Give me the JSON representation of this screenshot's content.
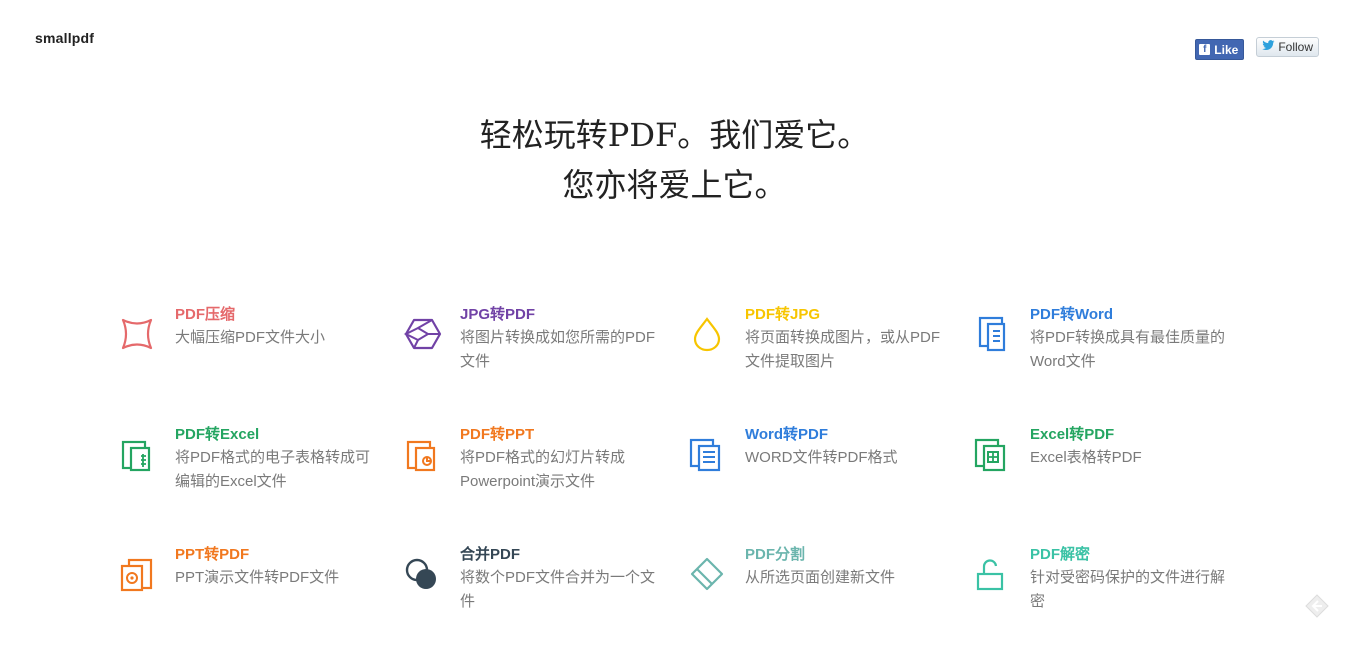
{
  "header": {
    "logo": "smallpdf",
    "fb_like_label": "Like",
    "twitter_follow_label": "Follow"
  },
  "hero": {
    "line1": "轻松玩转PDF。我们爱它。",
    "line2": "您亦将爱上它。"
  },
  "tools": [
    {
      "title": "PDF压缩",
      "desc": "大幅压缩PDF文件大小",
      "color": "#e5696b",
      "icon": "compress-icon"
    },
    {
      "title": "JPG转PDF",
      "desc": "将图片转换成如您所需的PDF文件",
      "color": "#7142a6",
      "icon": "cube-icon"
    },
    {
      "title": "PDF转JPG",
      "desc": "将页面转换成图片，或从PDF文件提取图片",
      "color": "#f7c500",
      "icon": "drop-icon"
    },
    {
      "title": "PDF转Word",
      "desc": "将PDF转换成具有最佳质量的Word文件",
      "color": "#2f7ddb",
      "icon": "word-doc-icon"
    },
    {
      "title": "PDF转Excel",
      "desc": "将PDF格式的电子表格转成可编辑的Excel文件",
      "color": "#24a561",
      "icon": "excel-doc-icon"
    },
    {
      "title": "PDF转PPT",
      "desc": "将PDF格式的幻灯片转成Powerpoint演示文件",
      "color": "#f1781f",
      "icon": "ppt-doc-icon"
    },
    {
      "title": "Word转PDF",
      "desc": "WORD文件转PDF格式",
      "color": "#2f7ddb",
      "icon": "word-lines-icon"
    },
    {
      "title": "Excel转PDF",
      "desc": "Excel表格转PDF",
      "color": "#24a561",
      "icon": "excel-grid-icon"
    },
    {
      "title": "PPT转PDF",
      "desc": "PPT演示文件转PDF文件",
      "color": "#f1781f",
      "icon": "ppt-chart-icon"
    },
    {
      "title": "合并PDF",
      "desc": "将数个PDF文件合并为一个文件",
      "color": "#354755",
      "icon": "merge-circles-icon"
    },
    {
      "title": "PDF分割",
      "desc": "从所选页面创建新文件",
      "color": "#6bb5ad",
      "icon": "split-diamond-icon"
    },
    {
      "title": "PDF解密",
      "desc": "针对受密码保护的文件进行解密",
      "color": "#3ac2a5",
      "icon": "unlock-icon"
    }
  ]
}
